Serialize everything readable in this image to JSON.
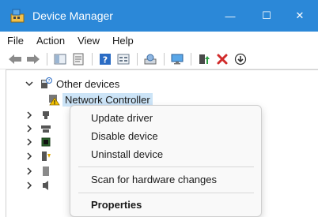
{
  "window": {
    "title": "Device Manager",
    "controls": {
      "minimize": "—",
      "maximize": "☐",
      "close": "✕"
    },
    "accent": "#2b88d8"
  },
  "menu": [
    "File",
    "Action",
    "View",
    "Help"
  ],
  "toolbar_icons": [
    "back-arrow-icon",
    "forward-arrow-icon",
    "properties-icon",
    "help-icon",
    "scan-icon",
    "monitor-icon",
    "update-driver-icon",
    "uninstall-icon",
    "download-icon"
  ],
  "tree": {
    "category": "Other devices",
    "selected_device": "Network Controller"
  },
  "context_menu": {
    "items": [
      "Update driver",
      "Disable device",
      "Uninstall device",
      "Scan for hardware changes",
      "Properties"
    ]
  }
}
